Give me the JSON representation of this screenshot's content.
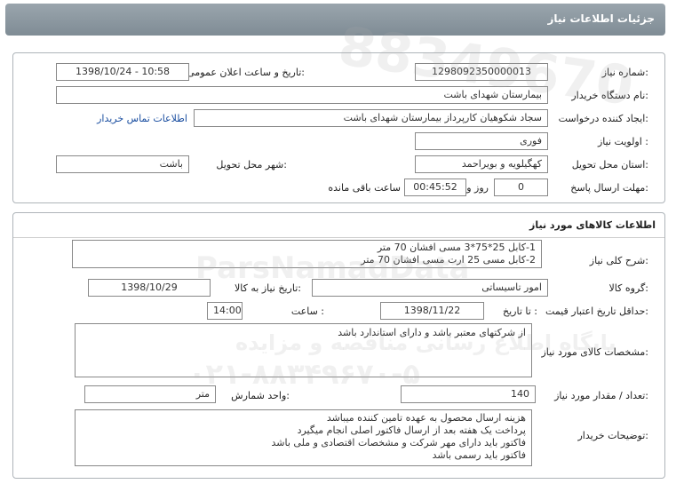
{
  "header": {
    "title": "جزئیات اطلاعات نیاز"
  },
  "details": {
    "need_number_label": "شماره نیاز:",
    "need_number": "1298092350000013",
    "announce_label": "تاریخ و ساعت اعلان عمومی:",
    "announce_value": "1398/10/24 - 10:58",
    "buyer_org_label": "نام دستگاه خریدار:",
    "buyer_org": "بیمارستان شهدای باشت",
    "creator_label": "ایجاد کننده درخواست:",
    "creator": "سجاد شکوهیان کارپرداز بیمارستان شهدای باشت",
    "contact_link": "اطلاعات تماس خریدار",
    "priority_label": "اولویت نیاز :",
    "priority": "فوری",
    "province_label": "استان محل تحویل:",
    "province": "کهگیلویه و بویراحمد",
    "city_label": "شهر محل تحویل:",
    "city": "باشت",
    "deadline_label": "مهلت ارسال پاسخ:",
    "days": "0",
    "days_word": "روز و",
    "time_left": "00:45:52",
    "time_left_suffix": "ساعت باقی مانده"
  },
  "goods": {
    "section_title": "اطلاعات کالاهای مورد نیاز",
    "summary_label": "شرح کلی نیاز:",
    "summary_lines": [
      "1-کابل 25*75*3 مسی افشان 70 متر",
      "2-کابل مسی 25 ارت مسی افشان 70 متر"
    ],
    "group_label": "گروه کالا:",
    "group": "امور تاسیساتی",
    "need_date_label": "تاریخ نیاز به کالا:",
    "need_date": "1398/10/29",
    "validity_label": "حداقل تاریخ اعتبار قیمت:",
    "until_label": "تا تاریخ :",
    "validity_date": "1398/11/22",
    "hour_label": "ساعت :",
    "validity_time": "14:00",
    "specs_label": "مشخصات کالای مورد نیاز:",
    "specs": "از شرکتهای معتبر باشد و دارای استاندارد باشد",
    "qty_label": "تعداد / مقدار مورد نیاز:",
    "qty": "140",
    "unit_label": "واحد شمارش:",
    "unit": "متر",
    "buyer_notes_label": "توضیحات خریدار:",
    "buyer_notes": [
      "هزینه ارسال محصول به عهده تامین کننده میباشد",
      "پرداخت یک هفته بعد از ارسال فاکتور اصلی انجام میگیرد",
      "فاکتور باید دارای مهر شرکت و مشخصات اقتصادی و ملی باشد",
      "فاکتور باید رسمی باشد"
    ]
  },
  "watermark": {
    "brand": "ParsNamadData",
    "phone_small": "88349670",
    "tagline": "پایگاه اطلاع رسانی مناقصه و مزایده",
    "phone": "۰۲۱-۸۸۳۴۹۶۷۰-۵"
  }
}
